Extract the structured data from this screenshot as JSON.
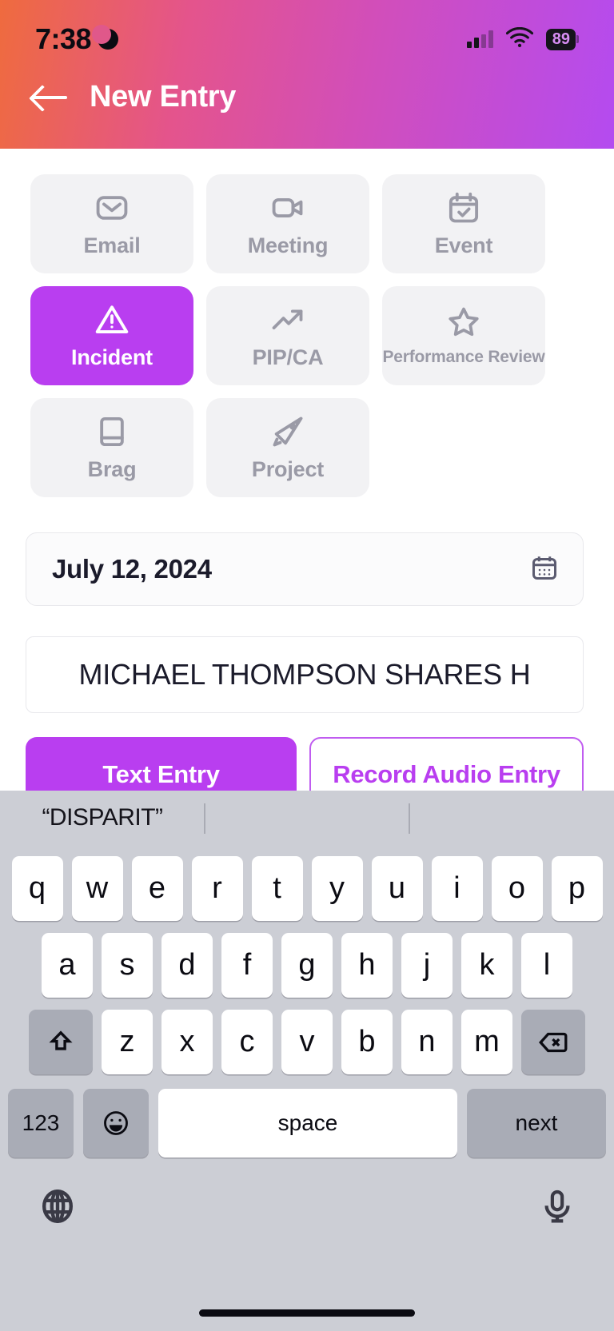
{
  "status_bar": {
    "time": "7:38",
    "moon_icon": "crescent-moon-icon",
    "signal_icon": "cellular-signal-icon",
    "wifi_icon": "wifi-icon",
    "battery_level": "89"
  },
  "nav": {
    "back_icon": "back-arrow-icon",
    "title": "New Entry"
  },
  "categories": [
    {
      "label": "Email",
      "icon": "envelope-icon",
      "selected": false
    },
    {
      "label": "Meeting",
      "icon": "video-camera-icon",
      "selected": false
    },
    {
      "label": "Event",
      "icon": "calendar-check-icon",
      "selected": false
    },
    {
      "label": "Incident",
      "icon": "warning-triangle-icon",
      "selected": true
    },
    {
      "label": "PIP/CA",
      "icon": "trending-up-icon",
      "selected": false
    },
    {
      "label": "Performance Review",
      "icon": "star-icon",
      "selected": false
    },
    {
      "label": "Brag",
      "icon": "book-icon",
      "selected": false
    },
    {
      "label": "Project",
      "icon": "rocket-icon",
      "selected": false
    }
  ],
  "date_field": {
    "value": "July 12, 2024",
    "icon": "calendar-icon"
  },
  "title_field": {
    "value": "MICHAEL THOMPSON SHARES H",
    "placeholder": "Title"
  },
  "actions": {
    "text_entry": "Text Entry",
    "record_audio": "Record Audio Entry"
  },
  "keyboard": {
    "suggestions": [
      "“DISPARIT”",
      "",
      ""
    ],
    "row1": [
      "q",
      "w",
      "e",
      "r",
      "t",
      "y",
      "u",
      "i",
      "o",
      "p"
    ],
    "row2": [
      "a",
      "s",
      "d",
      "f",
      "g",
      "h",
      "j",
      "k",
      "l"
    ],
    "row3": [
      "z",
      "x",
      "c",
      "v",
      "b",
      "n",
      "m"
    ],
    "shift_icon": "shift-arrow-icon",
    "backspace_icon": "backspace-delete-icon",
    "numbers_key": "123",
    "emoji_icon": "emoji-smiley-icon",
    "space_key": "space",
    "return_key": "next",
    "globe_icon": "globe-language-icon",
    "mic_icon": "microphone-icon"
  },
  "colors": {
    "accent": "#b93ef0",
    "header_gradient_start": "#ef6b3e",
    "header_gradient_end": "#b44bf0",
    "card_bg": "#f2f2f4",
    "card_text": "#9a9aa6",
    "keyboard_bg": "#ccced5"
  }
}
